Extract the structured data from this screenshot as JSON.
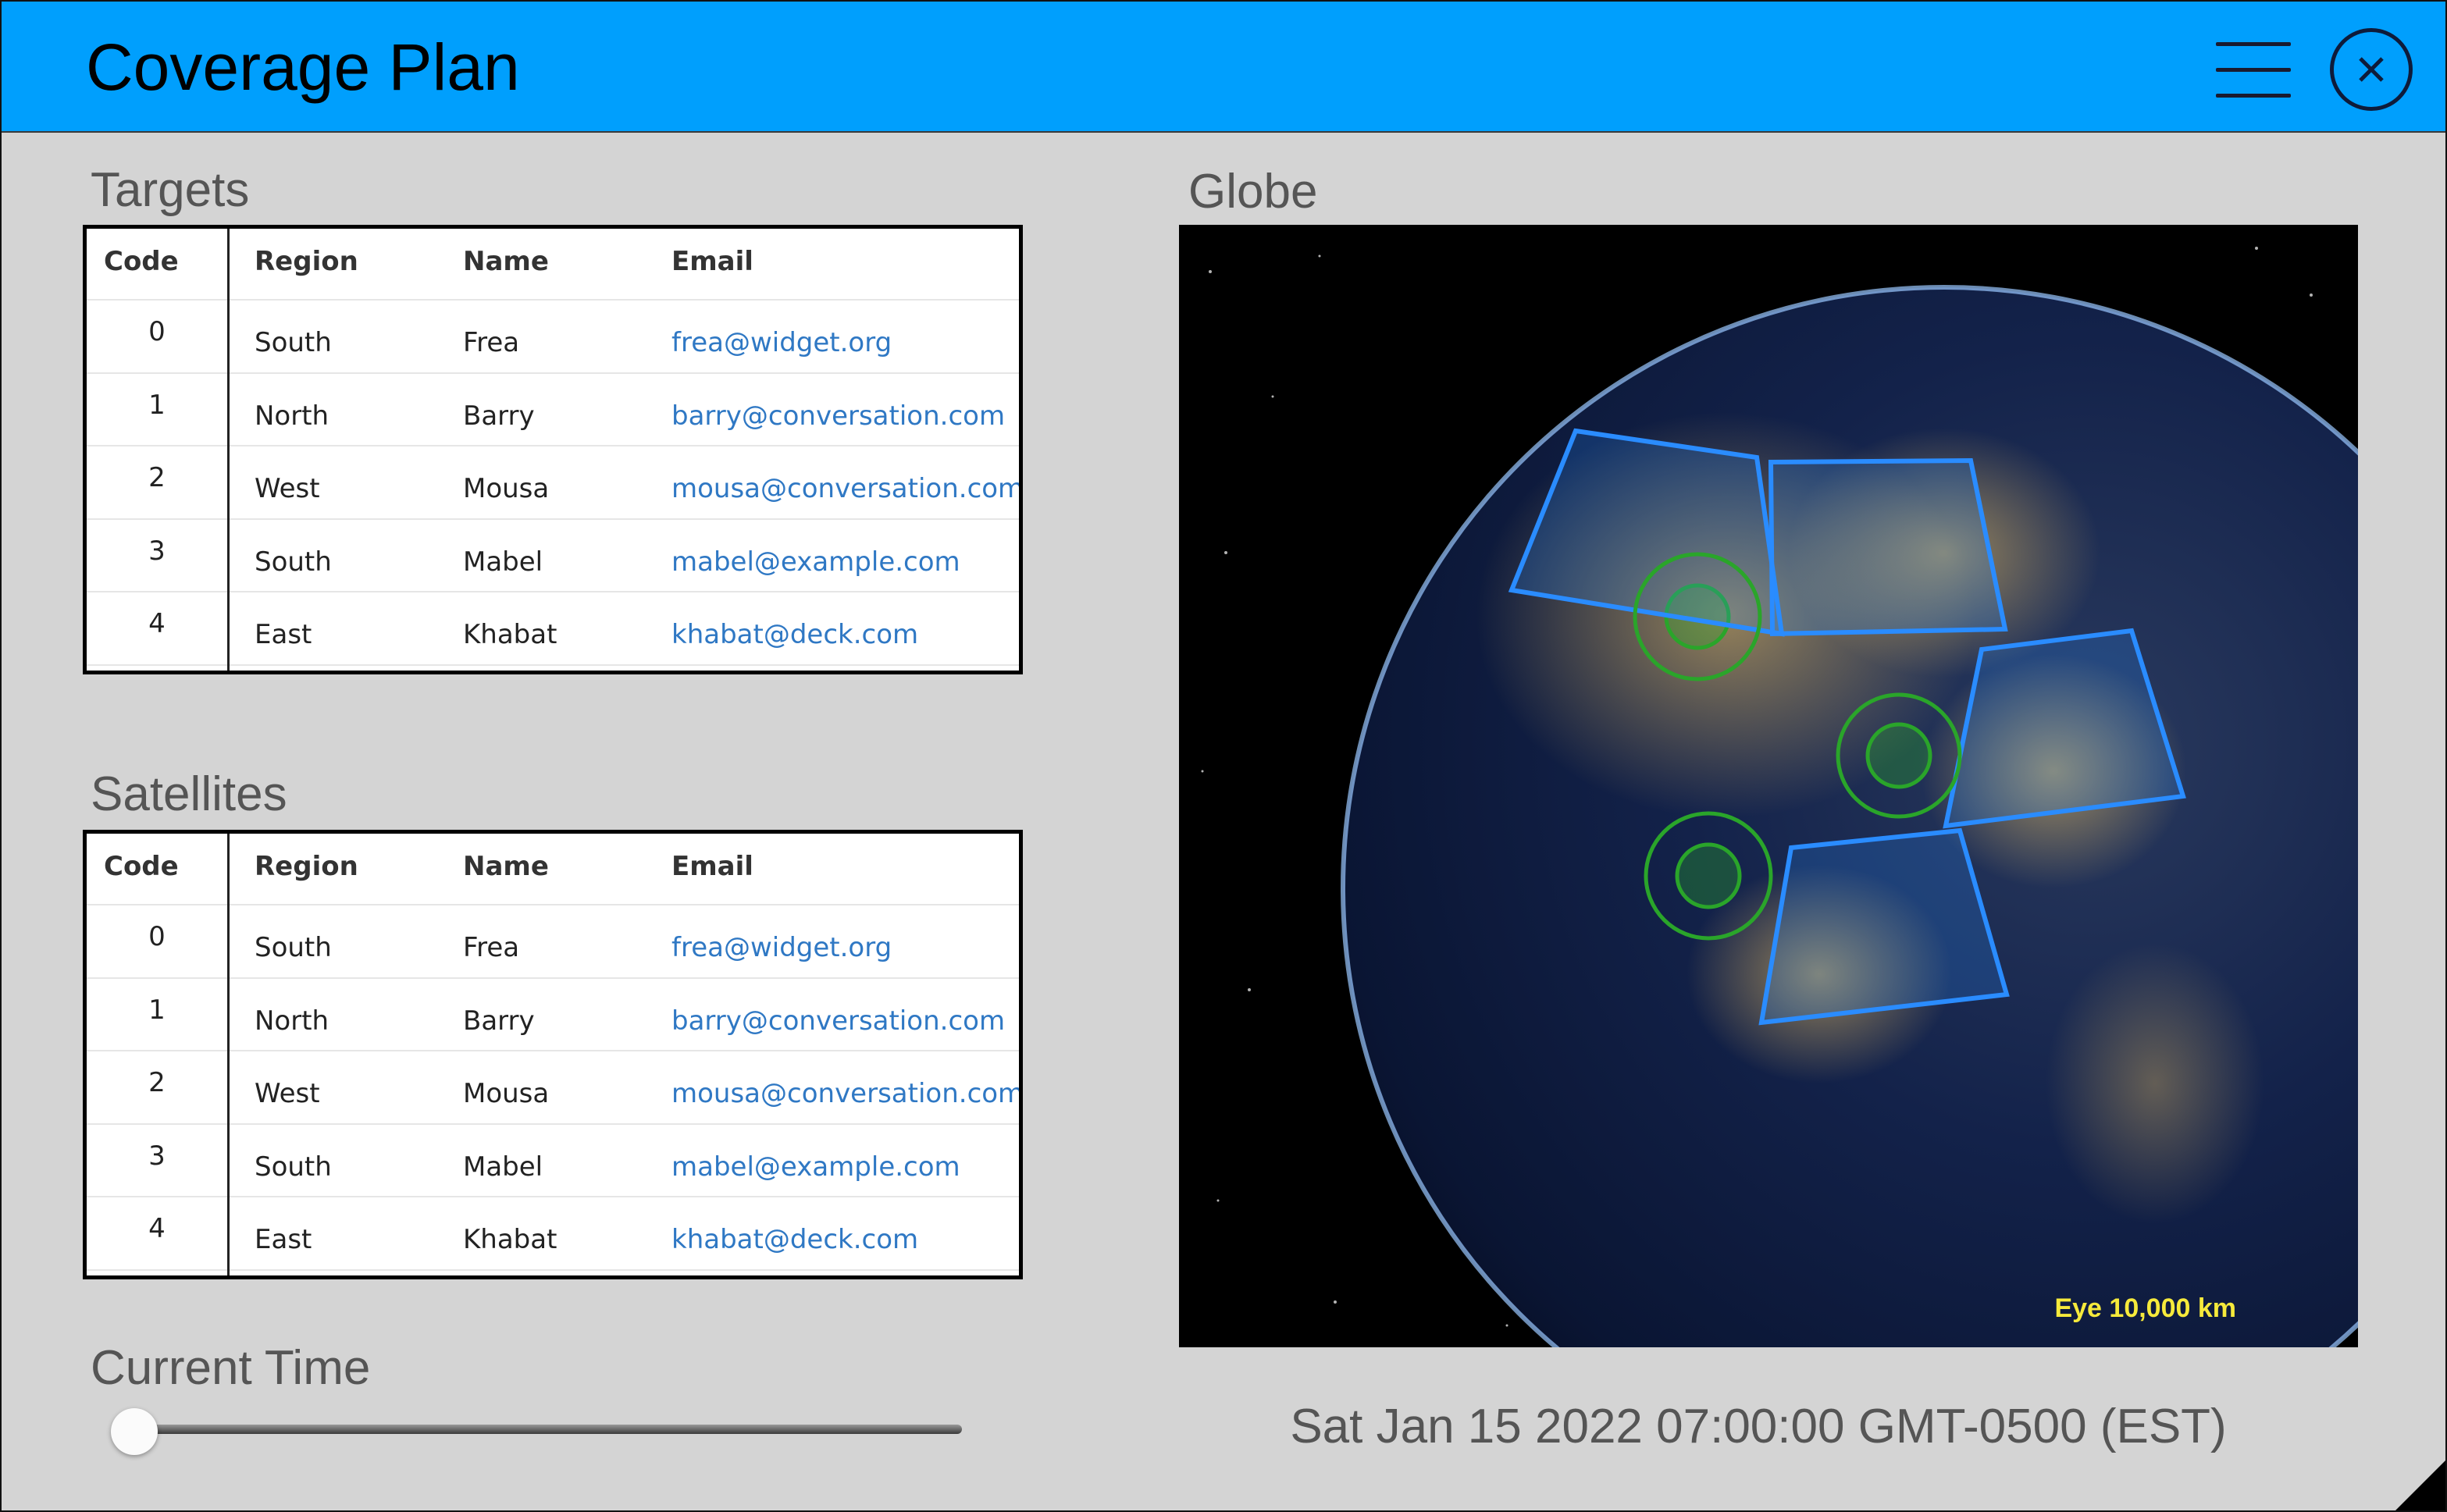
{
  "window": {
    "title": "Coverage Plan"
  },
  "sections": {
    "targets": "Targets",
    "satellites": "Satellites",
    "current_time": "Current Time",
    "globe": "Globe"
  },
  "tables": {
    "columns": [
      "Code",
      "Region",
      "Name",
      "Email"
    ],
    "targets": [
      {
        "code": "0",
        "region": "South",
        "name": "Frea",
        "email": "frea@widget.org"
      },
      {
        "code": "1",
        "region": "North",
        "name": "Barry",
        "email": "barry@conversation.com"
      },
      {
        "code": "2",
        "region": "West",
        "name": "Mousa",
        "email": "mousa@conversation.com"
      },
      {
        "code": "3",
        "region": "South",
        "name": "Mabel",
        "email": "mabel@example.com"
      },
      {
        "code": "4",
        "region": "East",
        "name": "Khabat",
        "email": "khabat@deck.com"
      }
    ],
    "satellites": [
      {
        "code": "0",
        "region": "South",
        "name": "Frea",
        "email": "frea@widget.org"
      },
      {
        "code": "1",
        "region": "North",
        "name": "Barry",
        "email": "barry@conversation.com"
      },
      {
        "code": "2",
        "region": "West",
        "name": "Mousa",
        "email": "mousa@conversation.com"
      },
      {
        "code": "3",
        "region": "South",
        "name": "Mabel",
        "email": "mabel@example.com"
      },
      {
        "code": "4",
        "region": "East",
        "name": "Khabat",
        "email": "khabat@deck.com"
      }
    ]
  },
  "time_slider": {
    "value_fraction": 0.0
  },
  "globe": {
    "eye_label": "Eye  10,000 km"
  },
  "current_time_text": "Sat Jan 15 2022 07:00:00 GMT-0500 (EST)",
  "icons": {
    "menu": "hamburger-menu-icon",
    "close": "close-icon",
    "resize": "resize-grip-icon"
  },
  "colors": {
    "titlebar": "#009ffd",
    "link": "#2f78c4",
    "footprint": "#2a8cff",
    "coverage": "#2aa52a"
  }
}
